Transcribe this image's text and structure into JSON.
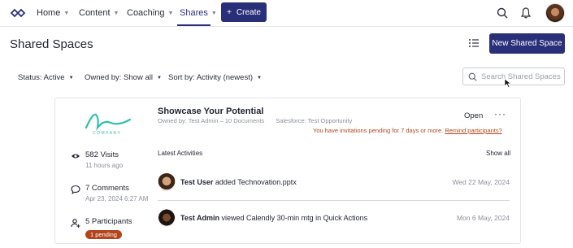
{
  "nav": {
    "items": [
      {
        "label": "Home"
      },
      {
        "label": "Content"
      },
      {
        "label": "Coaching"
      },
      {
        "label": "Shares"
      }
    ],
    "create_label": "Create",
    "create_icon": "plus-icon"
  },
  "header": {
    "title": "Shared Spaces",
    "new_button_label": "New Shared Space"
  },
  "filters": {
    "status": "Status: Active",
    "owned_by": "Owned by: Show all",
    "sort_by": "Sort by: Activity (newest)",
    "search_placeholder": "Search Shared Spaces"
  },
  "space": {
    "title": "Showcase Your Potential",
    "owner_line": "Owned by: Test Admin – 10 Documents",
    "salesforce_line": "Salesforce: Test Opportunity",
    "open_label": "Open",
    "more_label": "···",
    "warning_text": "You have invitations pending for 7 days or more.",
    "warning_link": "Remind participants?",
    "logo_text": "COMPANY",
    "stats": {
      "visits": "582 Visits",
      "visits_time": "11 hours ago",
      "comments": "7 Comments",
      "comments_time": "Apr 23, 2024 6:27 AM",
      "participants": "5 Participants",
      "pending_badge": "1 pending"
    },
    "activities_label": "Latest Activities",
    "show_all_label": "Show all",
    "activities": [
      {
        "user": "Test User",
        "action": "added Technovation.pptx",
        "date": "Wed 22 May, 2024"
      },
      {
        "user": "Test Admin",
        "action": "viewed Calendly 30-min mtg in Quick Actions",
        "date": "Mon 6 May, 2024"
      }
    ]
  },
  "colors": {
    "brand": "#2a2f7a",
    "warning": "#b2451d",
    "logo_teal": "#2fbfae"
  }
}
